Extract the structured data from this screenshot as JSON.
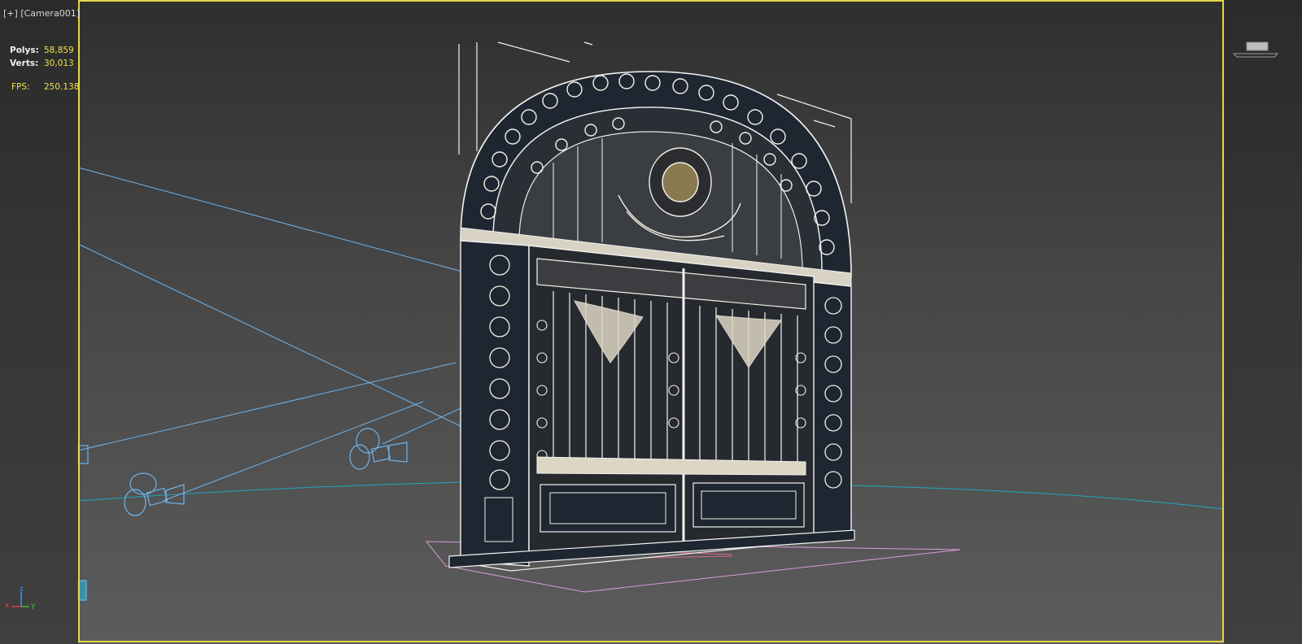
{
  "viewport": {
    "plus_menu": "[+]",
    "camera_menu": "[Camera001]"
  },
  "stats": {
    "polys_label": "Polys:",
    "polys_value": "58,859",
    "verts_label": "Verts:",
    "verts_value": "30,013",
    "fps_label": "FPS:",
    "fps_value": "250.138"
  },
  "axis": {
    "x": "x",
    "y": "y",
    "z": "z"
  },
  "colors": {
    "safe_frame": "#e3d84a",
    "stat_value": "#f3e24a",
    "camera_wire": "#6fb4ec",
    "grid_line": "#1fa7bf",
    "ground_plane": "#d79bd9",
    "wire": "#f2f2f2",
    "gate_body": "#1e2631"
  },
  "icons": {
    "viewcube": "viewcube-icon",
    "axis_tripod": "axis-tripod-icon",
    "camera": "camera-icon"
  }
}
